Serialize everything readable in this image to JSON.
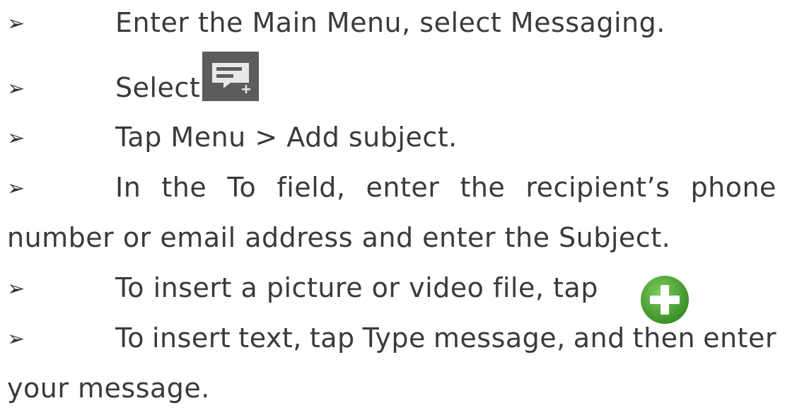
{
  "bullet_glyph": "➢",
  "steps": [
    {
      "text": "Enter the Main Menu, select Messaging."
    },
    {
      "text": "Select.",
      "icon": "compose-new-message-icon"
    },
    {
      "text": "Tap Menu > Add subject."
    },
    {
      "words": [
        "In",
        "the",
        "To",
        "field,",
        "enter",
        "the",
        "recipient’s",
        "phone"
      ],
      "continuation": "number or email address and enter the Subject."
    },
    {
      "text": "To insert a picture or video file, tap",
      "icon": "green-plus-icon"
    },
    {
      "words": [
        "To",
        "insert",
        "text,",
        "tap",
        "Type",
        "message,",
        "and",
        "then",
        "enter"
      ],
      "continuation": "your message."
    }
  ],
  "colors": {
    "text": "#3a3a3a",
    "compose_icon_bg": "#5c5c5c",
    "plus_icon": "#3f9a2c"
  }
}
